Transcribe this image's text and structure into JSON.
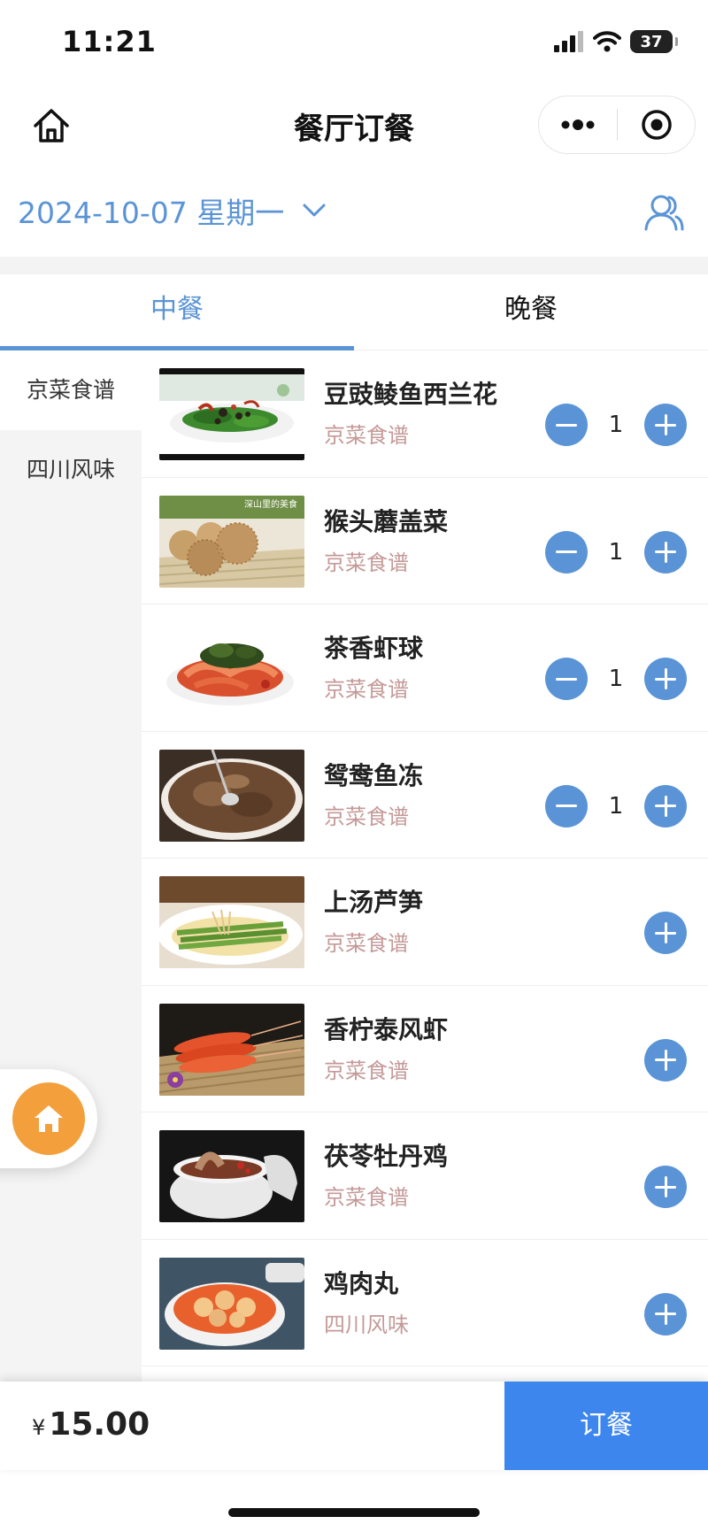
{
  "status_bar": {
    "time": "11:21",
    "battery": "37"
  },
  "navbar": {
    "title": "餐厅订餐"
  },
  "date_row": {
    "date": "2024-10-07 星期一"
  },
  "tabs": [
    {
      "label": "中餐",
      "active": true
    },
    {
      "label": "晚餐",
      "active": false
    }
  ],
  "sidebar": {
    "items": [
      {
        "label": "京菜食谱",
        "active": true
      },
      {
        "label": "四川风味",
        "active": false
      }
    ]
  },
  "dishes": [
    {
      "name": "豆豉鲮鱼西兰花",
      "category": "京菜食谱",
      "qty": "1",
      "show_minus": true
    },
    {
      "name": "猴头蘑盖菜",
      "category": "京菜食谱",
      "qty": "1",
      "show_minus": true
    },
    {
      "name": "茶香虾球",
      "category": "京菜食谱",
      "qty": "1",
      "show_minus": true
    },
    {
      "name": "鸳鸯鱼冻",
      "category": "京菜食谱",
      "qty": "1",
      "show_minus": true
    },
    {
      "name": "上汤芦笋",
      "category": "京菜食谱",
      "qty": "",
      "show_minus": false
    },
    {
      "name": "香柠泰风虾",
      "category": "京菜食谱",
      "qty": "",
      "show_minus": false
    },
    {
      "name": "茯苓牡丹鸡",
      "category": "京菜食谱",
      "qty": "",
      "show_minus": false
    },
    {
      "name": "鸡肉丸",
      "category": "四川风味",
      "qty": "",
      "show_minus": false
    }
  ],
  "thumb_text": {
    "dish_2": "深山里的美食"
  },
  "bottom_bar": {
    "currency": "¥",
    "total": "15.00",
    "order_label": "订餐"
  },
  "colors": {
    "accent": "#5b94d6",
    "order_button": "#3d86ee",
    "category_text": "#c49a98",
    "float_home": "#f3a03c"
  }
}
